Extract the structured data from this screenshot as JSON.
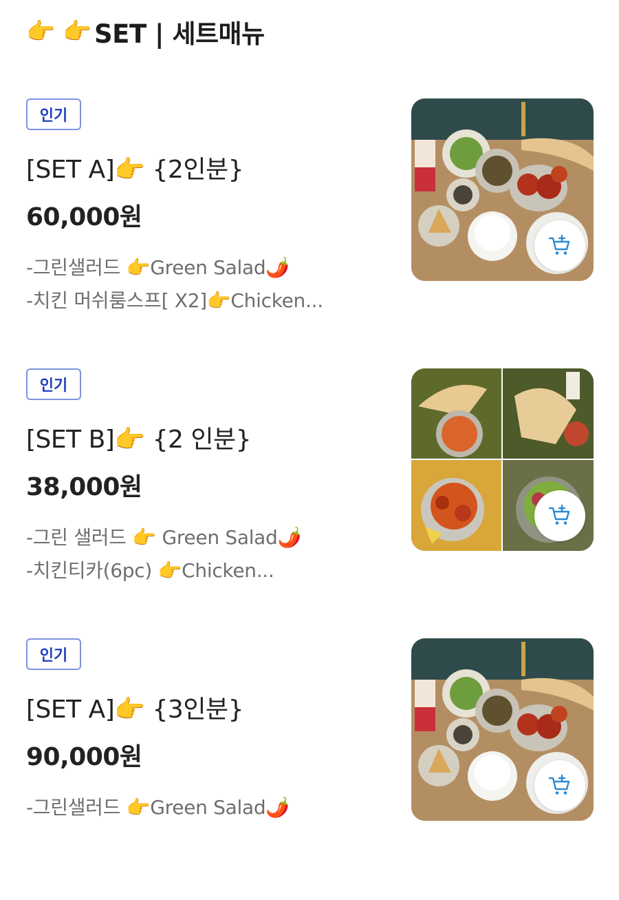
{
  "header": {
    "emoji": "👉 👉",
    "title": "SET | 세트매뉴"
  },
  "items": [
    {
      "badge": "인기",
      "title": "[SET A]👉 {2인분}",
      "price": "60,000원",
      "desc_lines": [
        "-그린샐러드 👉Green Salad🌶️",
        "-치킨 머쉬룸스프[ X2]👉Chicken..."
      ],
      "image": "indian-set-meal-photo-a",
      "cart_icon": "cart-add-icon"
    },
    {
      "badge": "인기",
      "title": "[SET B]👉 {2 인분}",
      "price": "38,000원",
      "desc_lines": [
        "-그린 샐러드 👉 Green Salad🌶️",
        "-치킨티카(6pc) 👉Chicken..."
      ],
      "image": "indian-set-meal-photo-b",
      "cart_icon": "cart-add-icon"
    },
    {
      "badge": "인기",
      "title": "[SET A]👉 {3인분}",
      "price": "90,000원",
      "desc_lines": [
        "-그린샐러드 👉Green Salad🌶️"
      ],
      "image": "indian-set-meal-photo-a",
      "cart_icon": "cart-add-icon"
    }
  ],
  "colors": {
    "badge_border": "#7d93e0",
    "badge_text": "#1f3fbf",
    "cart_icon": "#2a8ad6",
    "desc_text": "#6e6e6e"
  }
}
